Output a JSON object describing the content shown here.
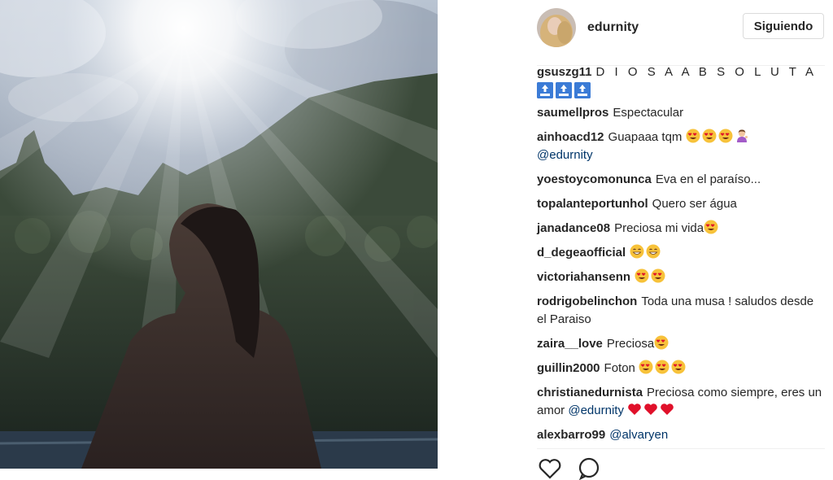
{
  "post": {
    "username": "edurnity",
    "follow_label": "Siguiendo"
  },
  "comments": [
    {
      "user": "gsuszg11",
      "text": "D I O S A A B S O L U T A",
      "extra_count": 3,
      "extra_icon": "top-arrow-emoji"
    },
    {
      "user": "saumellpros",
      "text": "Espectacular"
    },
    {
      "user": "ainhoacd12",
      "text": "Guapaaa tqm",
      "emojis": [
        "heart-eyes-emoji",
        "heart-eyes-emoji",
        "heart-eyes-emoji",
        "woman-tipping-hand-emoji"
      ],
      "mention": "@edurnity"
    },
    {
      "user": "yoestoycomonunca",
      "text": "Eva en el paraíso..."
    },
    {
      "user": "topalanteportunhol",
      "text": "Quero ser água"
    },
    {
      "user": "janadance08",
      "text": "Preciosa mi vida",
      "emojis": [
        "heart-eyes-emoji"
      ]
    },
    {
      "user": "d_degeaofficial",
      "text": "",
      "emojis": [
        "grinning-emoji",
        "grinning-emoji"
      ]
    },
    {
      "user": "victoriahansenn",
      "text": "",
      "emojis": [
        "heart-eyes-emoji",
        "heart-eyes-emoji"
      ]
    },
    {
      "user": "rodrigobelinchon",
      "text": "Toda una musa ! saludos desde el Paraiso"
    },
    {
      "user": "zaira__love",
      "text": "Preciosa",
      "emojis": [
        "heart-eyes-emoji"
      ]
    },
    {
      "user": "guillin2000",
      "text": "Foton",
      "emojis": [
        "heart-eyes-emoji",
        "heart-eyes-emoji",
        "heart-eyes-emoji"
      ]
    },
    {
      "user": "christianedurnista",
      "text": "Preciosa como siempre, eres un amor",
      "mention": "@edurnity",
      "emojis_after_mention": [
        "red-heart-emoji",
        "red-heart-emoji",
        "red-heart-emoji"
      ]
    },
    {
      "user": "alexbarro99",
      "text": "",
      "mention": "@alvaryen"
    }
  ],
  "icons": {
    "like": "heart-outline-icon",
    "comment": "comment-bubble-icon"
  },
  "colors": {
    "link": "#003569",
    "heart": "#e0102a",
    "emoji_face": "#f7c23a",
    "top_box": "#3b7bd6"
  }
}
